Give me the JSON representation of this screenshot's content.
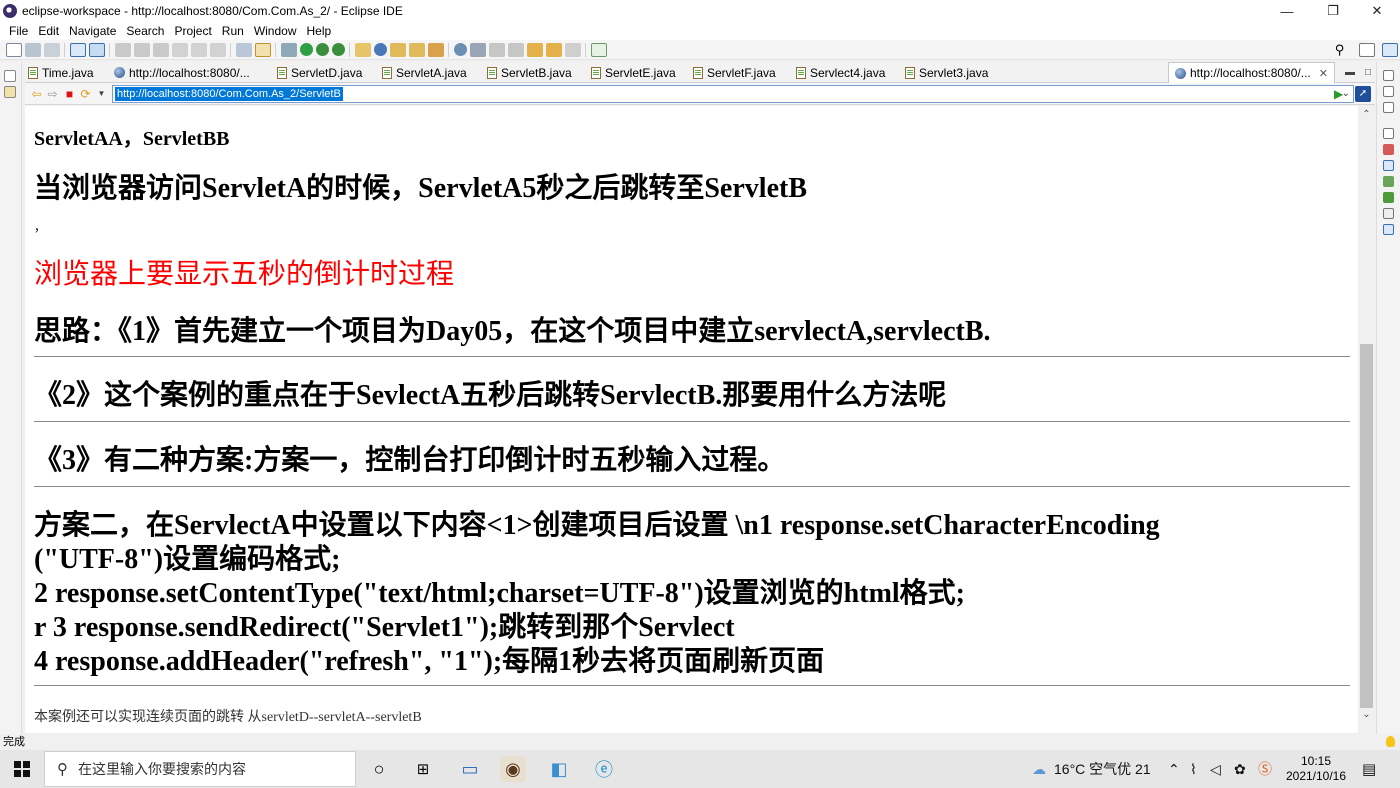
{
  "window": {
    "title": "eclipse-workspace - http://localhost:8080/Com.Com.As_2/ - Eclipse IDE",
    "minimize": "—",
    "maximize": "❐",
    "close": "✕"
  },
  "menu": [
    "File",
    "Edit",
    "Navigate",
    "Search",
    "Project",
    "Run",
    "Window",
    "Help"
  ],
  "tabs": [
    {
      "label": "Time.java",
      "type": "java"
    },
    {
      "label": "http://localhost:8080/...",
      "type": "web"
    },
    {
      "label": "ServletD.java",
      "type": "java"
    },
    {
      "label": "ServletA.java",
      "type": "java"
    },
    {
      "label": "ServletB.java",
      "type": "java"
    },
    {
      "label": "ServletE.java",
      "type": "java"
    },
    {
      "label": "ServletF.java",
      "type": "java"
    },
    {
      "label": "Servlect4.java",
      "type": "java"
    },
    {
      "label": "Servlet3.java",
      "type": "java"
    },
    {
      "label": "http://localhost:8080/...",
      "type": "web",
      "active": true,
      "close": "✕"
    }
  ],
  "browser": {
    "url": "http://localhost:8080/Com.Com.As_2/ServletB",
    "lines": {
      "l1": "ServletAA，ServletBB",
      "l2": "当浏览器访问ServletA的时候，ServletA5秒之后跳转至ServletB",
      "l3": "，",
      "l4": "浏览器上要显示五秒的倒计时过程",
      "l5": "思路：《1》首先建立一个项目为Day05，在这个项目中建立servlectA,servlectB.",
      "l6": "《2》这个案例的重点在于SevlectA五秒后跳转ServlectB.那要用什么方法呢",
      "l7": "《3》有二种方案:方案一，控制台打印倒计时五秒输入过程。",
      "l8": "方案二，在ServlectA中设置以下内容<1>创建项目后设置 \\n1 response.setCharacterEncoding",
      "l9": "(\"UTF-8\")设置编码格式;",
      "l10": "2 response.setContentType(\"text/html;charset=UTF-8\")设置浏览的html格式;",
      "l11": "r 3 response.sendRedirect(\"Servlet1\");跳转到那个Servlect",
      "l12": "4 response.addHeader(\"refresh\", \"1\");每隔1秒去将页面刷新页面",
      "l13": "本案例还可以实现连续页面的跳转 从servletD--servletA--servletB"
    },
    "highlight_color": "#ff0000"
  },
  "status": "完成",
  "taskbar": {
    "search_placeholder": "在这里输入你要搜索的内容",
    "weather": "16°C  空气优 21",
    "time": "10:15",
    "date": "2021/10/16"
  }
}
